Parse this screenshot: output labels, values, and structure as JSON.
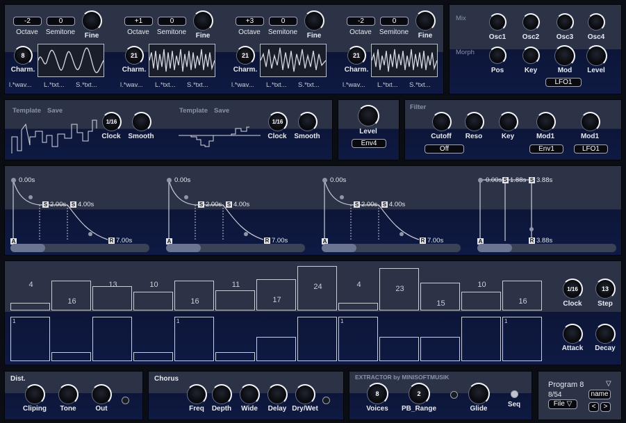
{
  "oscillators": [
    {
      "octave": "-2",
      "semitone": "0",
      "charm": "8",
      "file1": "l.*wav...",
      "file2": "L.*txt...",
      "file3": "S.*txt..."
    },
    {
      "octave": "+1",
      "semitone": "0",
      "charm": "21",
      "file1": "l.*wav...",
      "file2": "L.*txt...",
      "file3": "S.*txt..."
    },
    {
      "octave": "+3",
      "semitone": "0",
      "charm": "21",
      "file1": "l.*wav...",
      "file2": "L.*txt...",
      "file3": "S.*txt..."
    },
    {
      "octave": "-2",
      "semitone": "0",
      "charm": "21",
      "file1": "l.*wav...",
      "file2": "L.*txt...",
      "file3": "S.*txt..."
    }
  ],
  "osc_labels": {
    "octave": "Octave",
    "semitone": "Semitone",
    "fine": "Fine",
    "charm": "Charm."
  },
  "mix": {
    "title": "Mix",
    "morph_title": "Morph",
    "osc1": "Osc1",
    "osc2": "Osc2",
    "osc3": "Osc3",
    "osc4": "Osc4",
    "pos": "Pos",
    "key": "Key",
    "mod": "Mod",
    "level": "Level",
    "lfo": "LFO1"
  },
  "templates": {
    "template": "Template",
    "save": "Save",
    "clock_val": "1/16",
    "clock": "Clock",
    "smooth": "Smooth"
  },
  "level_panel": {
    "level": "Level",
    "env": "Env4"
  },
  "filter": {
    "title": "Filter",
    "cutoff": "Cutoff",
    "reso": "Reso",
    "key": "Key",
    "mod1": "Mod1",
    "mod2": "Mod1",
    "off": "Off",
    "env": "Env1",
    "lfo": "LFO1"
  },
  "envelopes": [
    {
      "t0": "0.00s",
      "t1": "2.00s",
      "t2": "4.00s",
      "t3": "7.00s"
    },
    {
      "t0": "0.00s",
      "t1": "2.00s",
      "t2": "4.00s",
      "t3": "7.00s"
    },
    {
      "t0": "0.00s",
      "t1": "2.00s",
      "t2": "4.00s",
      "t3": "7.00s"
    },
    {
      "t0": "0.00s",
      "t1": "1.88s",
      "t2": "3.88s",
      "t3": "3.88s"
    }
  ],
  "env_nodes": {
    "a": "A",
    "s": "S",
    "r": "R"
  },
  "sequencer": {
    "values": [
      "4",
      "16",
      "13",
      "10",
      "16",
      "11",
      "17",
      "24",
      "4",
      "23",
      "15",
      "10",
      "16"
    ],
    "levels": [
      4,
      16,
      13,
      10,
      16,
      11,
      17,
      24,
      4,
      23,
      15,
      10,
      16
    ],
    "gates": [
      1,
      0.2,
      1,
      0.2,
      1,
      0.2,
      0.55,
      1,
      1,
      0.55,
      0.55,
      1,
      1
    ],
    "gate_labels": [
      "1",
      "",
      "",
      "",
      "1",
      "",
      "",
      "",
      "1",
      "",
      "",
      "",
      "1"
    ],
    "clock_val": "1/16",
    "clock": "Clock",
    "step_val": "13",
    "step": "Step",
    "attack": "Attack",
    "decay": "Decay"
  },
  "dist": {
    "title": "Dist.",
    "cliping": "Cliping",
    "tone": "Tone",
    "out": "Out"
  },
  "chorus": {
    "title": "Chorus",
    "freq": "Freq",
    "depth": "Depth",
    "wide": "Wide",
    "delay": "Delay",
    "drywet": "Dry/Wet"
  },
  "extractor": {
    "title": "EXTRACTOR by MINISOFTMUSIK",
    "voices_val": "8",
    "voices": "Voices",
    "pb_val": "2",
    "pb": "PB_Range",
    "glide": "Glide",
    "seq": "Seq"
  },
  "program": {
    "name": "Program 8",
    "count": "8/54",
    "file": "File",
    "name_btn": "name",
    "prev": "<",
    "next": ">",
    "arrow": "▽",
    "file_arrow": "▽"
  }
}
